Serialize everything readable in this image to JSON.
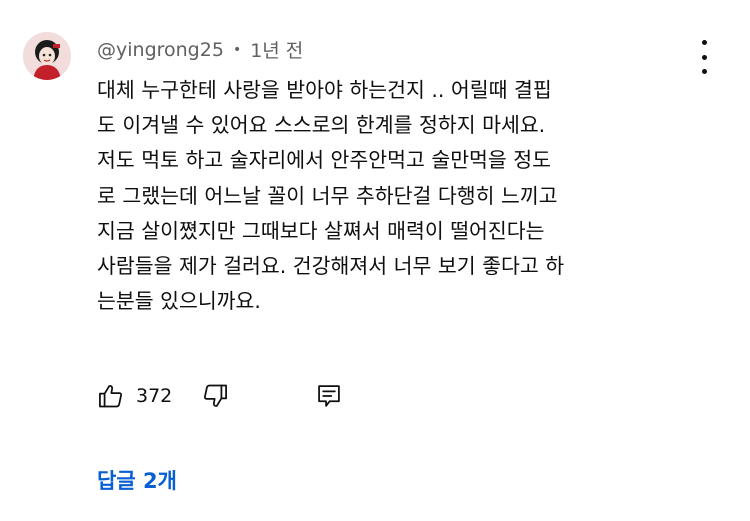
{
  "comment": {
    "author": "@yingrong25",
    "separator": "•",
    "time": "1년 전",
    "lines": [
      "대체 누구한테 사랑을 받아야 하는건지 .. 어릴때 결핍",
      "도 이겨낼 수 있어요 스스로의 한계를 정하지 마세요.",
      "저도 먹토 하고 술자리에서 안주안먹고 술만먹을 정도",
      "로 그랬는데 어느날 꼴이 너무 추하단걸 다행히 느끼고",
      "지금 살이쪘지만 그때보다 살쪄서 매력이 떨어진다는",
      "사람들을 제가 걸러요. 건강해져서 너무 보기 좋다고 하",
      "는분들 있으니까요."
    ],
    "like_count": "372",
    "replies_label": "답글 2개"
  },
  "icons": {
    "avatar": "avatar-image",
    "menu": "more-vertical-icon",
    "like": "thumbs-up-icon",
    "dislike": "thumbs-down-icon",
    "reply": "reply-icon"
  },
  "colors": {
    "text": "#0f0f0f",
    "secondary": "#606060",
    "link": "#065fd4"
  }
}
